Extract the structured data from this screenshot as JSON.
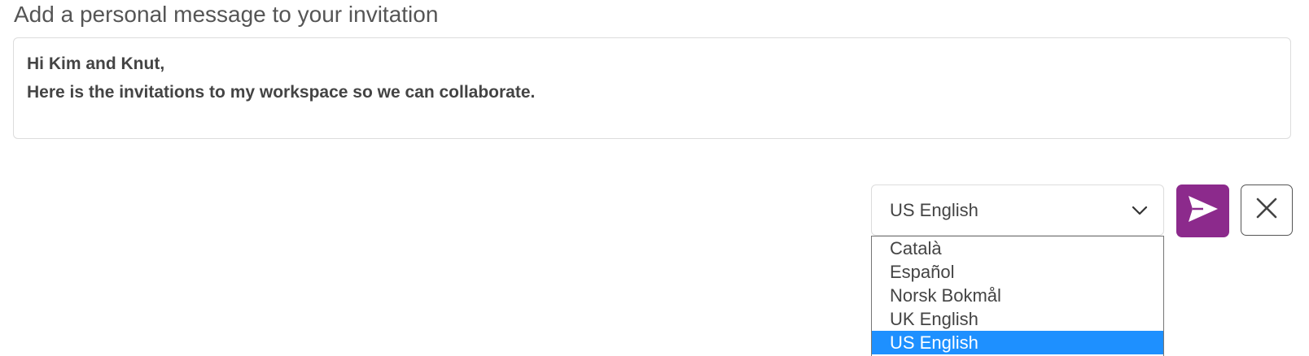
{
  "heading": "Add a personal message to your invitation",
  "message": {
    "lines": [
      "Hi Kim and Knut,",
      "Here is the invitations to my workspace so we can collaborate."
    ]
  },
  "language_select": {
    "selected": "US English",
    "options": [
      "Català",
      "Español",
      "Norsk Bokmål",
      "UK English",
      "US English"
    ],
    "selected_index": 4
  },
  "buttons": {
    "send_icon": "send-icon",
    "close_icon": "close-icon"
  },
  "colors": {
    "send_button_bg": "#8c2a8c",
    "selected_option_bg": "#1e90ff"
  }
}
